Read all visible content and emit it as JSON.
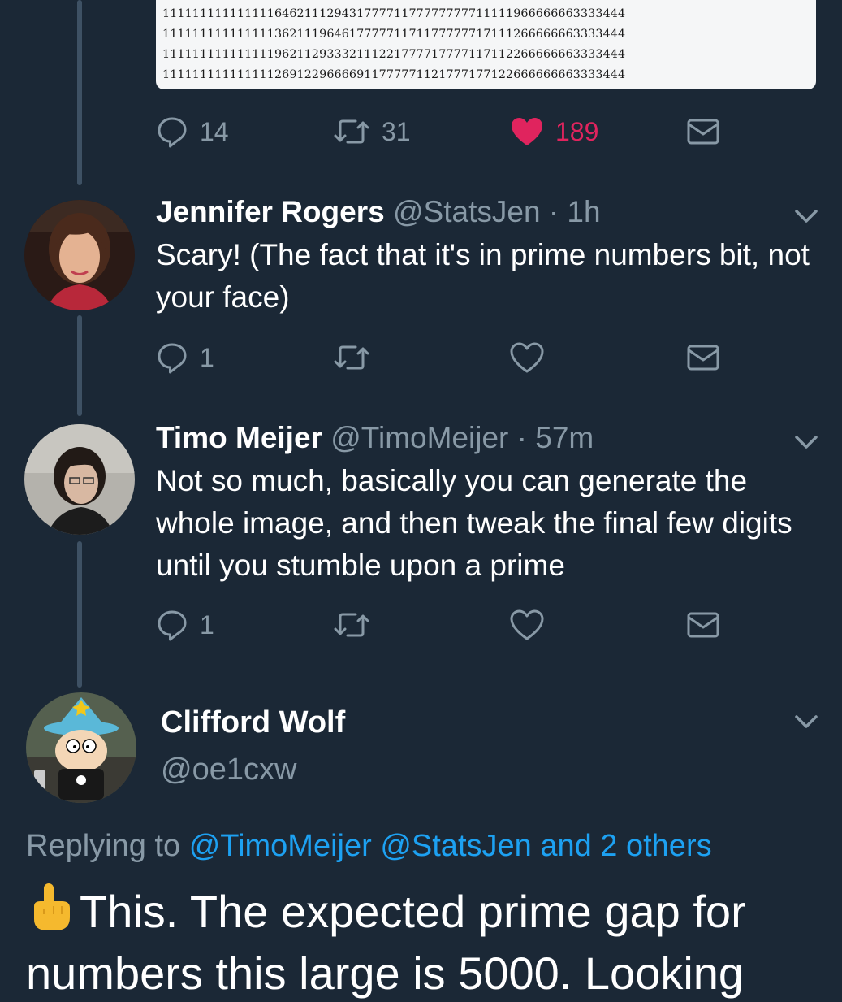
{
  "colors": {
    "background": "#1b2836",
    "secondary_text": "#8899a6",
    "link": "#1da1f2",
    "like": "#e0245e",
    "thread_line": "#3e5164"
  },
  "image_rows": [
    "11111111111111164621112943177771177777777711111966666663333444",
    "11111111111111136211196461777771171177777717111266666663333444",
    "11111111111111196211293332111221777717777117112266666663333444",
    "11111111111111126912296666911777771121777177122666666663333444"
  ],
  "top_tweet": {
    "reply_count": "14",
    "retweet_count": "31",
    "like_count": "189",
    "icons": [
      "reply-icon",
      "retweet-icon",
      "heart-filled-icon",
      "mail-icon"
    ]
  },
  "tweets": [
    {
      "name": "Jennifer Rogers",
      "handle": "@StatsJen",
      "time": "· 1h",
      "text": "Scary! (The fact that it's in prime numbers bit, not your face)",
      "reply_count": "1"
    },
    {
      "name": "Timo Meijer",
      "handle": "@TimoMeijer",
      "time": "· 57m",
      "text": "Not so much, basically you can generate the whole image, and then tweak the final few digits until you stumble upon a prime",
      "reply_count": "1"
    }
  ],
  "focus_tweet": {
    "name": "Clifford Wolf",
    "handle": "@oe1cxw",
    "replying_prefix": "Replying to",
    "replying_link_1": "@TimoMeijer",
    "replying_link_2": "@StatsJen",
    "replying_link_3": "and 2 others",
    "emoji_icon": "pointing-up-hand-icon",
    "text": "This. The expected prime gap for numbers this large is 5000. Looking"
  }
}
